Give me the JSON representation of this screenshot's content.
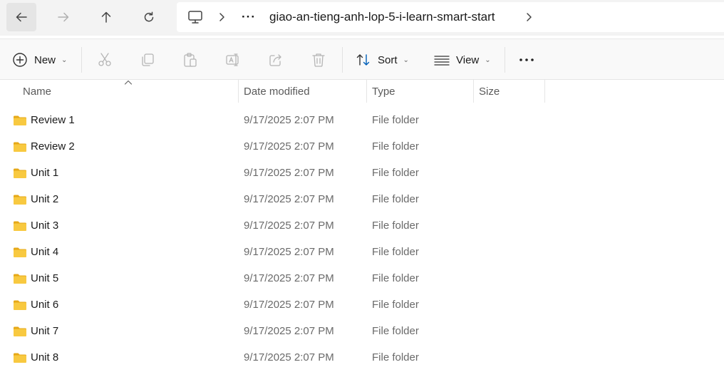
{
  "nav": {
    "back": "back-arrow",
    "forward": "forward-arrow",
    "up": "up-arrow",
    "refresh": "refresh"
  },
  "address": {
    "overflow": "···",
    "folder": "giao-an-tieng-anh-lop-5-i-learn-smart-start"
  },
  "toolbar": {
    "new_label": "New",
    "sort_label": "Sort",
    "view_label": "View",
    "more": "···"
  },
  "columns": {
    "name": "Name",
    "date": "Date modified",
    "type": "Type",
    "size": "Size"
  },
  "colors": {
    "folder": "#f8c940",
    "folder_dark": "#e6a817",
    "accent": "#005fb8"
  },
  "files": [
    {
      "name": "Review 1",
      "date": "9/17/2025 2:07 PM",
      "type": "File folder",
      "size": ""
    },
    {
      "name": "Review 2",
      "date": "9/17/2025 2:07 PM",
      "type": "File folder",
      "size": ""
    },
    {
      "name": "Unit 1",
      "date": "9/17/2025 2:07 PM",
      "type": "File folder",
      "size": ""
    },
    {
      "name": "Unit 2",
      "date": "9/17/2025 2:07 PM",
      "type": "File folder",
      "size": ""
    },
    {
      "name": "Unit 3",
      "date": "9/17/2025 2:07 PM",
      "type": "File folder",
      "size": ""
    },
    {
      "name": "Unit 4",
      "date": "9/17/2025 2:07 PM",
      "type": "File folder",
      "size": ""
    },
    {
      "name": "Unit 5",
      "date": "9/17/2025 2:07 PM",
      "type": "File folder",
      "size": ""
    },
    {
      "name": "Unit 6",
      "date": "9/17/2025 2:07 PM",
      "type": "File folder",
      "size": ""
    },
    {
      "name": "Unit 7",
      "date": "9/17/2025 2:07 PM",
      "type": "File folder",
      "size": ""
    },
    {
      "name": "Unit 8",
      "date": "9/17/2025 2:07 PM",
      "type": "File folder",
      "size": ""
    }
  ]
}
